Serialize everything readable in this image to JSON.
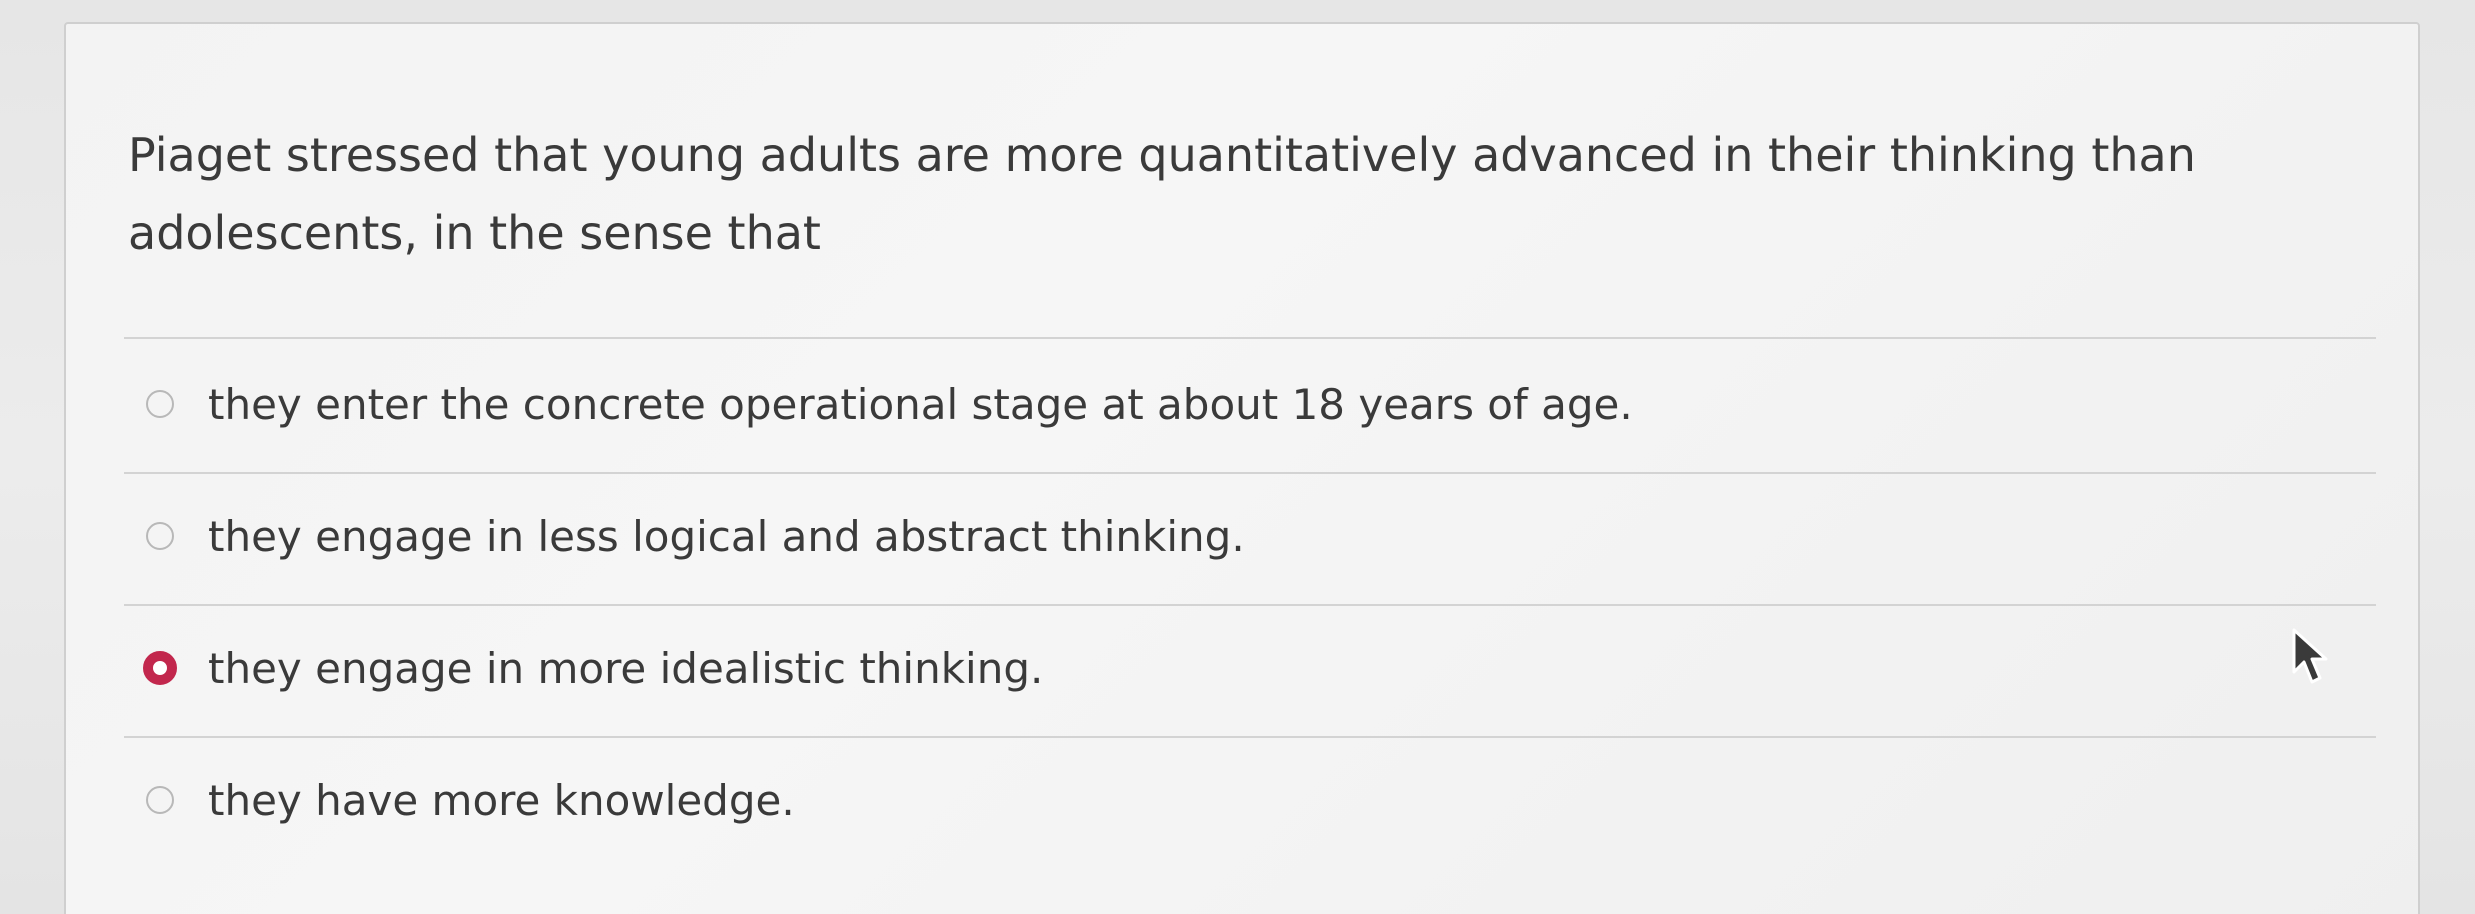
{
  "question": {
    "text": "Piaget stressed that young adults are more quantitatively advanced in their thinking than adolescents, in the sense that"
  },
  "options": [
    {
      "label": "they enter the concrete operational stage at about 18 years of age.",
      "selected": false
    },
    {
      "label": "they engage in less logical and abstract thinking.",
      "selected": false
    },
    {
      "label": "they engage in more idealistic thinking.",
      "selected": true
    },
    {
      "label": "they have more knowledge.",
      "selected": false
    }
  ],
  "colors": {
    "selected_radio": "#c2274d",
    "text": "#3a3a3a",
    "divider": "#d3d3d3"
  },
  "icons": {
    "cursor": "mouse-pointer-icon"
  }
}
